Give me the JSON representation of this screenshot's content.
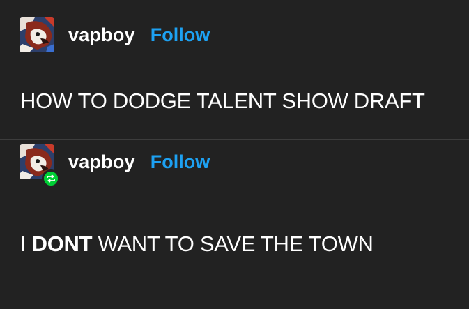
{
  "posts": [
    {
      "username": "vapboy",
      "follow_label": "Follow",
      "text": "HOW TO DODGE TALENT SHOW DRAFT",
      "reblogged": false
    },
    {
      "username": "vapboy",
      "follow_label": "Follow",
      "text_parts": [
        "I ",
        "DONT",
        " WANT TO SAVE THE TOWN"
      ],
      "reblogged": true
    }
  ],
  "icons": {
    "avatar": "avatar-image",
    "reblog": "reblog-icon"
  },
  "colors": {
    "background": "#222222",
    "follow": "#1da1f2",
    "reblog_badge": "#00cf35",
    "divider": "#3d3d3d"
  }
}
